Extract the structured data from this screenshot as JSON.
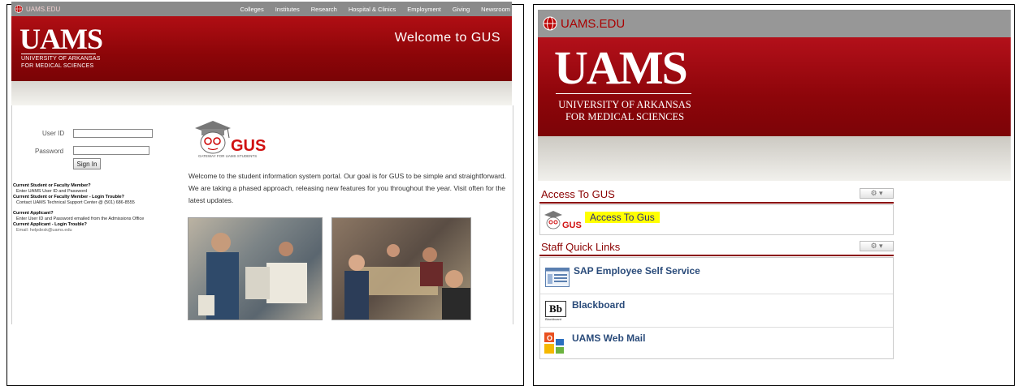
{
  "left": {
    "site_link": "UAMS.EDU",
    "nav": [
      "Colleges",
      "Institutes",
      "Research",
      "Hospital & Clinics",
      "Employment",
      "Giving",
      "Newsroom"
    ],
    "logo": "UAMS",
    "logo_sub_1": "UNIVERSITY OF ARKANSAS",
    "logo_sub_2": "FOR MEDICAL SCIENCES",
    "welcome": "Welcome to GUS",
    "login": {
      "user_label": "User ID",
      "password_label": "Password",
      "sign_in": "Sign In"
    },
    "info": {
      "h1": "Current Student or Faculty Member?",
      "t1": "Enter UAMS User ID and Password",
      "h2": "Current Student or Faculty Member - Login Trouble?",
      "t2": "Contact UAMS Technical Support Center @ (501) 686-8555",
      "h3": "Current Applicant?",
      "t3": "Enter User ID and Password emailed from the Admissions Office",
      "h4": "Current Applicant - Login Trouble?",
      "t4": "Email: helpdesk@uams.edu"
    },
    "gus_logo_text": "GUS",
    "gus_tagline": "GATEWAY FOR UAMS STUDENTS",
    "welcome_text": "Welcome to the student information system portal.  Our goal is for GUS to be simple and straightforward.  We are taking a phased approach, releasing new features for you        throughout the year.  Visit often for the latest updates."
  },
  "right": {
    "site_link": "UAMS.EDU",
    "logo": "UAMS",
    "logo_sub_1": "UNIVERSITY OF ARKANSAS",
    "logo_sub_2": "FOR MEDICAL SCIENCES",
    "portlet1_title": "Access To GUS",
    "portlet1_link": "Access To Gus",
    "portlet2_title": "Staff Quick Links",
    "links": [
      {
        "label": "SAP Employee Self Service"
      },
      {
        "label": "Blackboard",
        "icon_text": "Bb",
        "icon_sub": "Blackboard"
      },
      {
        "label": "UAMS Web Mail"
      }
    ],
    "gear": "⚙ ▾"
  },
  "colors": {
    "uams_red": "#8c0508",
    "link_blue": "#2a4b7a",
    "highlight": "#ffff00"
  }
}
